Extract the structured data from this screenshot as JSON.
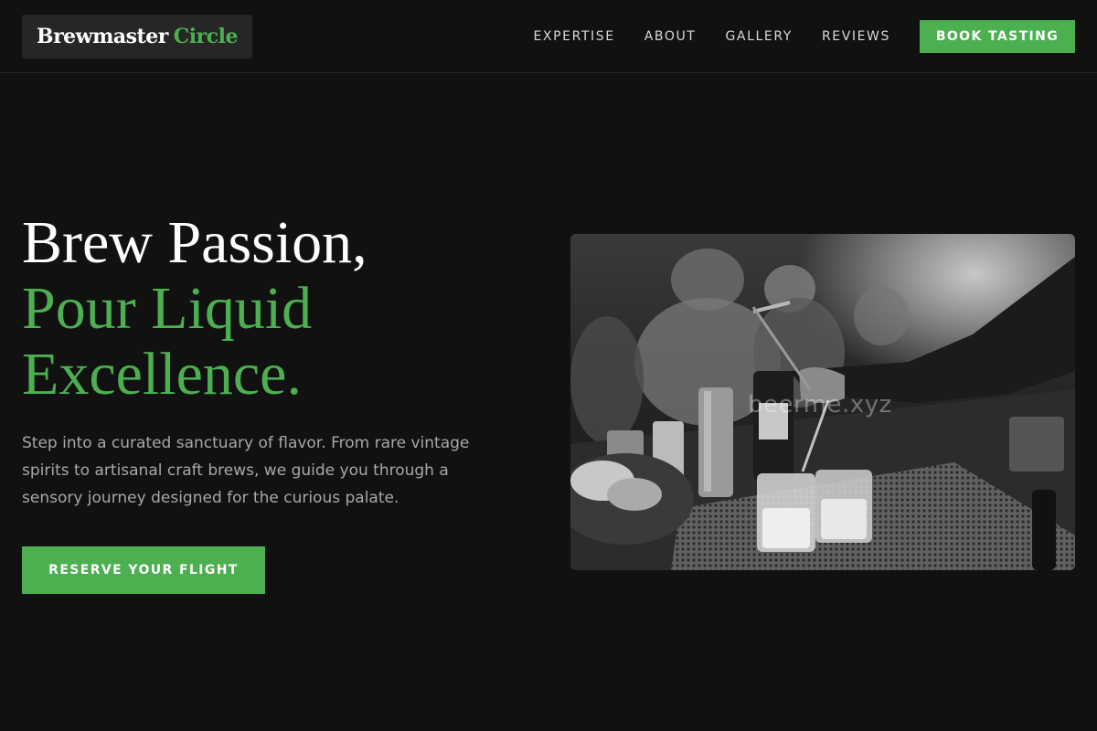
{
  "header": {
    "logo": {
      "main": "Brewmaster",
      "accent": "Circle"
    },
    "nav": [
      {
        "label": "EXPERTISE"
      },
      {
        "label": "ABOUT"
      },
      {
        "label": "GALLERY"
      },
      {
        "label": "REVIEWS"
      }
    ],
    "cta_label": "BOOK TASTING"
  },
  "hero": {
    "title_line1": "Brew Passion,",
    "title_line2": "Pour Liquid",
    "title_line3": "Excellence.",
    "description": "Step into a curated sanctuary of flavor. From rare vintage spirits to artisanal craft brews, we guide you through a sensory journey designed for the curious palate.",
    "cta_label": "RESERVE YOUR FLIGHT"
  },
  "photo": {
    "watermark": "beerme.xyz"
  },
  "colors": {
    "accent": "#4caf50",
    "background": "#111111"
  }
}
